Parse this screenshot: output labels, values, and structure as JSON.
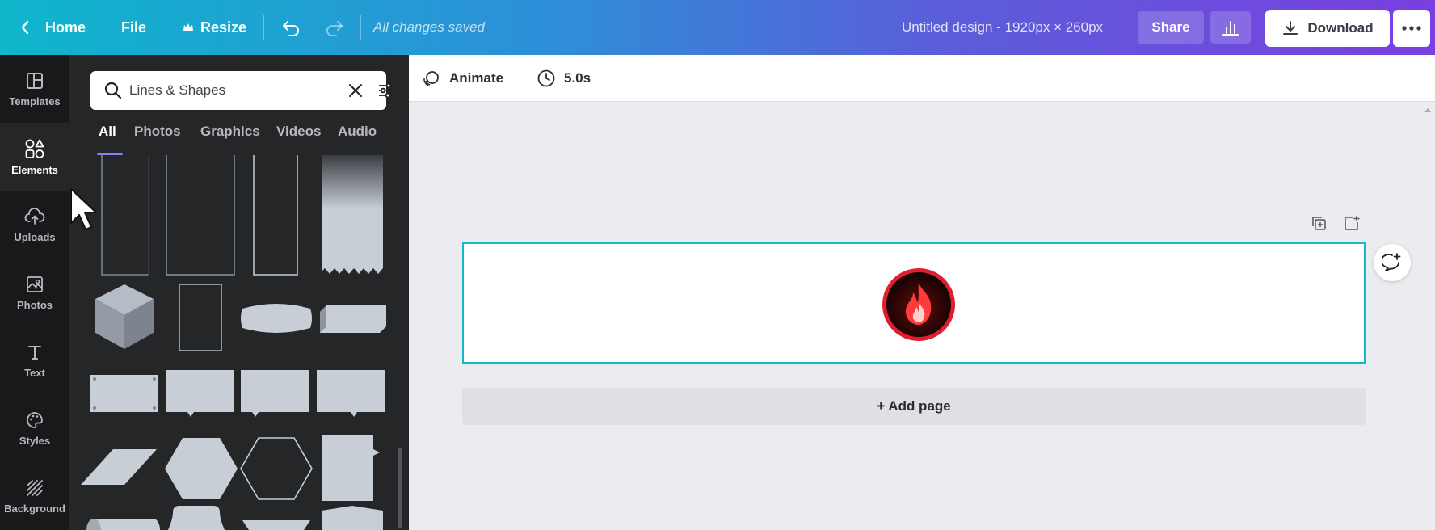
{
  "topbar": {
    "home_label": "Home",
    "file_label": "File",
    "resize_label": "Resize",
    "saved_status": "All changes saved",
    "doc_title": "Untitled design - 1920px × 260px",
    "share_label": "Share",
    "download_label": "Download"
  },
  "rail": {
    "items": [
      {
        "label": "Templates",
        "icon": "templates-icon"
      },
      {
        "label": "Elements",
        "icon": "elements-icon"
      },
      {
        "label": "Uploads",
        "icon": "cloud-upload-icon"
      },
      {
        "label": "Photos",
        "icon": "image-icon"
      },
      {
        "label": "Text",
        "icon": "text-icon"
      },
      {
        "label": "Styles",
        "icon": "palette-icon"
      },
      {
        "label": "Background",
        "icon": "hatch-icon"
      }
    ],
    "active": "Elements"
  },
  "panel": {
    "search_value": "Lines & Shapes",
    "tabs": [
      "All",
      "Photos",
      "Graphics",
      "Videos",
      "Audio"
    ],
    "active_tab": "All"
  },
  "toolbar": {
    "animate_label": "Animate",
    "duration_label": "5.0s"
  },
  "canvas": {
    "add_page_label": "+ Add page"
  },
  "colors": {
    "accent": "#14b8c8",
    "tab_underline": "#8b7ff6",
    "shape_fill": "#c7ced6"
  }
}
